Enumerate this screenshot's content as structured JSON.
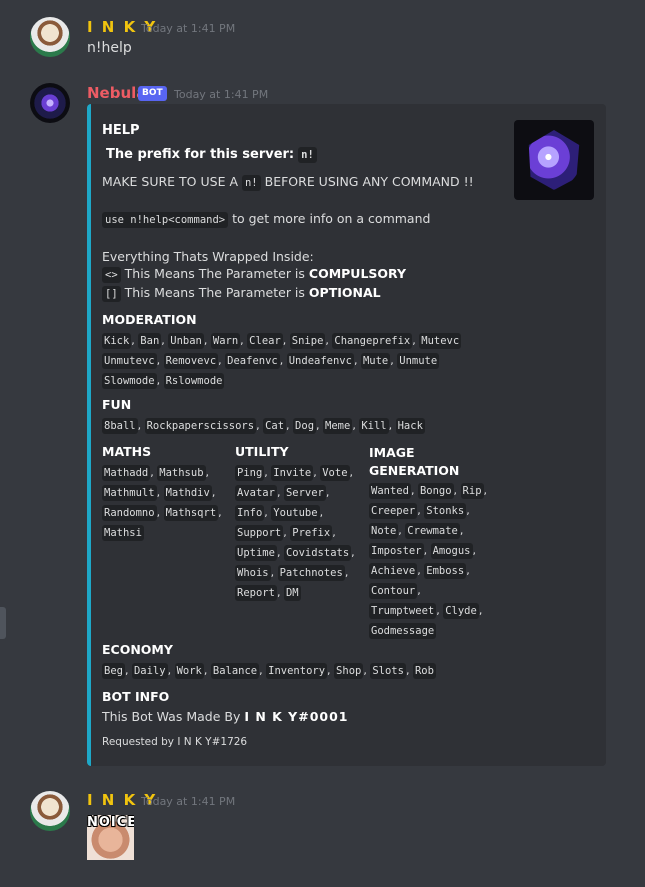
{
  "messages": {
    "m1": {
      "author": "I N K Y",
      "timestamp": "Today at 1:41 PM",
      "text": "n!help"
    },
    "m2": {
      "author": "Nebula",
      "bot_tag": "BOT",
      "timestamp": "Today at 1:41 PM"
    },
    "m3": {
      "author": "I N K Y",
      "timestamp": "Today at 1:41 PM",
      "image_text": "NOICE"
    }
  },
  "embed": {
    "title": "HELP",
    "prefix_label": "The prefix for this server:",
    "prefix_code": "n!",
    "warn_before": "MAKE SURE TO USE A",
    "warn_code": "n!",
    "warn_after": "BEFORE USING ANY COMMAND !!",
    "usage_code": "use n!help<command>",
    "usage_after": "to get more info on a command",
    "wrapped_label": "Everything Thats Wrapped Inside:",
    "compulsory_code": "<>",
    "compulsory_text": "This Means The Parameter is",
    "compulsory_bold": "COMPULSORY",
    "optional_code": "[]",
    "optional_text": "This Means The Parameter is",
    "optional_bold": "OPTIONAL",
    "moderation": {
      "name": "MODERATION",
      "line1": [
        "Kick",
        "Ban",
        "Unban",
        "Warn",
        "Clear",
        "Snipe",
        "Changeprefix",
        "Mutevc"
      ],
      "line2": [
        "Unmutevc",
        "Removevc",
        "Deafenvc",
        "Undeafenvc",
        "Mute",
        "Unmute"
      ],
      "line3": [
        "Slowmode",
        "Rslowmode"
      ]
    },
    "fun": {
      "name": "FUN",
      "line1": [
        "8ball",
        "Rockpaperscissors",
        "Cat",
        "Dog",
        "Meme",
        "Kill",
        "Hack"
      ]
    },
    "maths": {
      "name": "MATHS",
      "lines": [
        [
          "Mathadd",
          "Mathsub"
        ],
        [
          "Mathmult",
          "Mathdiv"
        ],
        [
          "Randomno",
          "Mathsqrt"
        ],
        [
          "Mathsi"
        ]
      ]
    },
    "utility": {
      "name": "UTILITY",
      "lines": [
        [
          "Ping",
          "Invite",
          "Vote"
        ],
        [
          "Avatar",
          "Server"
        ],
        [
          "Info",
          "Youtube"
        ],
        [
          "Support",
          "Prefix"
        ],
        [
          "Uptime",
          "Covidstats"
        ],
        [
          "Whois",
          "Patchnotes"
        ],
        [
          "Report",
          "DM"
        ]
      ]
    },
    "image_gen": {
      "name_line1": "IMAGE",
      "name_line2": "GENERATION",
      "lines": [
        [
          "Wanted",
          "Bongo",
          "Rip"
        ],
        [
          "Creeper",
          "Stonks"
        ],
        [
          "Note",
          "Crewmate"
        ],
        [
          "Imposter",
          "Amogus"
        ],
        [
          "Achieve",
          "Emboss"
        ],
        [
          "Contour"
        ],
        [
          "Trumptweet",
          "Clyde"
        ],
        [
          "Godmessage"
        ]
      ]
    },
    "economy": {
      "name": "ECONOMY",
      "line1": [
        "Beg",
        "Daily",
        "Work",
        "Balance",
        "Inventory",
        "Shop",
        "Slots",
        "Rob"
      ]
    },
    "bot_info": {
      "name": "BOT INFO",
      "text": "This Bot Was Made By",
      "bold": "I N K Y#0001"
    },
    "footer": "Requested by I N K Y#1726"
  }
}
